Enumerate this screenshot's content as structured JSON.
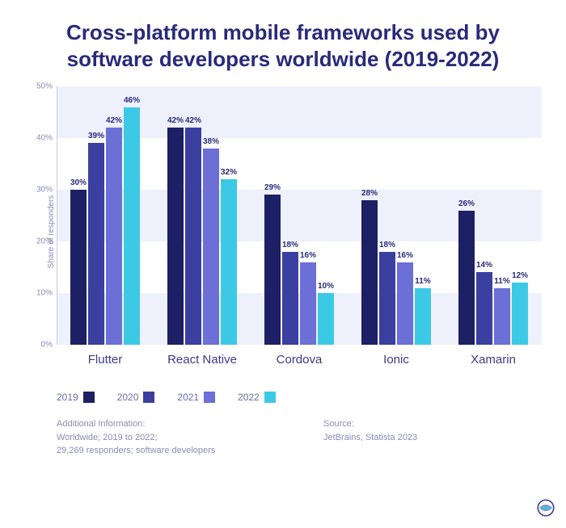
{
  "chart_data": {
    "type": "bar",
    "title": "Cross-platform mobile frameworks used by software developers worldwide (2019-2022)",
    "ylabel": "Share of responders",
    "xlabel": "",
    "ylim": [
      0,
      50
    ],
    "y_ticks": [
      0,
      10,
      20,
      30,
      40,
      50
    ],
    "y_tick_labels": [
      "0%",
      "10%",
      "20%",
      "30%",
      "40%",
      "50%"
    ],
    "categories": [
      "Flutter",
      "React Native",
      "Cordova",
      "Ionic",
      "Xamarin"
    ],
    "series": [
      {
        "name": "2019",
        "color": "#1d2064",
        "values": [
          30,
          42,
          29,
          28,
          26
        ]
      },
      {
        "name": "2020",
        "color": "#3b3fa0",
        "values": [
          39,
          42,
          18,
          18,
          14
        ]
      },
      {
        "name": "2021",
        "color": "#6b6fd6",
        "values": [
          42,
          38,
          16,
          16,
          11
        ]
      },
      {
        "name": "2022",
        "color": "#3cc9e6",
        "values": [
          46,
          32,
          10,
          11,
          12
        ]
      }
    ]
  },
  "footer": {
    "info_heading": "Additional Information:",
    "info_line1": "Worldwide; 2019 to 2022;",
    "info_line2": "29,269 responders; software developers",
    "source_heading": "Source:",
    "source_line": "JetBrains, Statista 2023"
  }
}
